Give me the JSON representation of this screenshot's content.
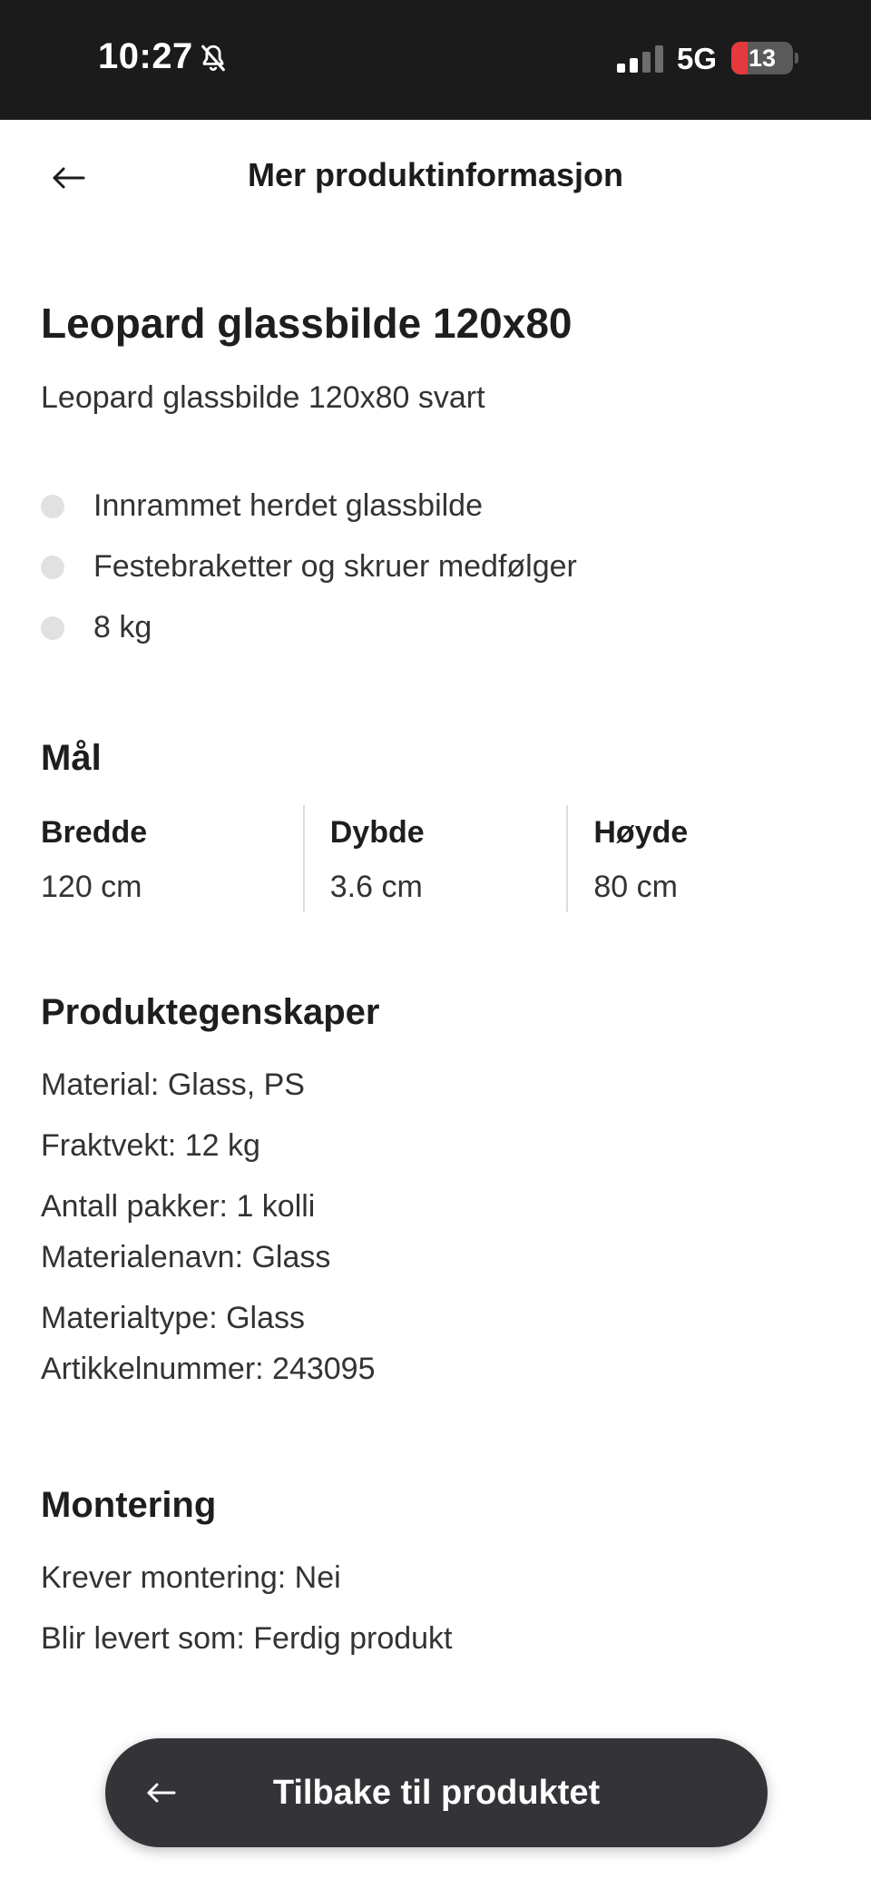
{
  "status_bar": {
    "time": "10:27",
    "network": "5G",
    "battery": "13",
    "battery_level": 0.13,
    "icons": [
      "bell-slash-icon",
      "signal-icon",
      "battery-icon"
    ]
  },
  "header": {
    "title": "Mer produktinformasjon",
    "back_icon": "arrow-left-icon"
  },
  "product": {
    "title": "Leopard glassbilde 120x80",
    "subtitle": "Leopard glassbilde 120x80 svart",
    "bullets": [
      "Innrammet herdet glassbilde",
      "Festebraketter og skruer medfølger",
      "8 kg"
    ]
  },
  "dimensions": {
    "title": "Mål",
    "items": [
      {
        "label": "Bredde",
        "value": "120 cm"
      },
      {
        "label": "Dybde",
        "value": "3.6 cm"
      },
      {
        "label": "Høyde",
        "value": "80 cm"
      }
    ]
  },
  "properties": {
    "title": "Produktegenskaper",
    "items": [
      "Material: Glass, PS",
      "Fraktvekt: 12 kg",
      "Antall pakker: 1 kolli",
      "Materialenavn: Glass",
      "Materialtype: Glass",
      "Artikkelnummer: 243095"
    ]
  },
  "mounting": {
    "title": "Montering",
    "items": [
      "Krever montering: Nei",
      "Blir levert som: Ferdig produkt"
    ]
  },
  "bottom_button": {
    "label": "Tilbake til produktet",
    "icon": "arrow-left-icon"
  },
  "colors": {
    "status_bar_bg": "#1b1b1b",
    "button_bg": "#343438",
    "battery_low": "#e5393d",
    "bullet_dot": "#e1e1e1"
  }
}
